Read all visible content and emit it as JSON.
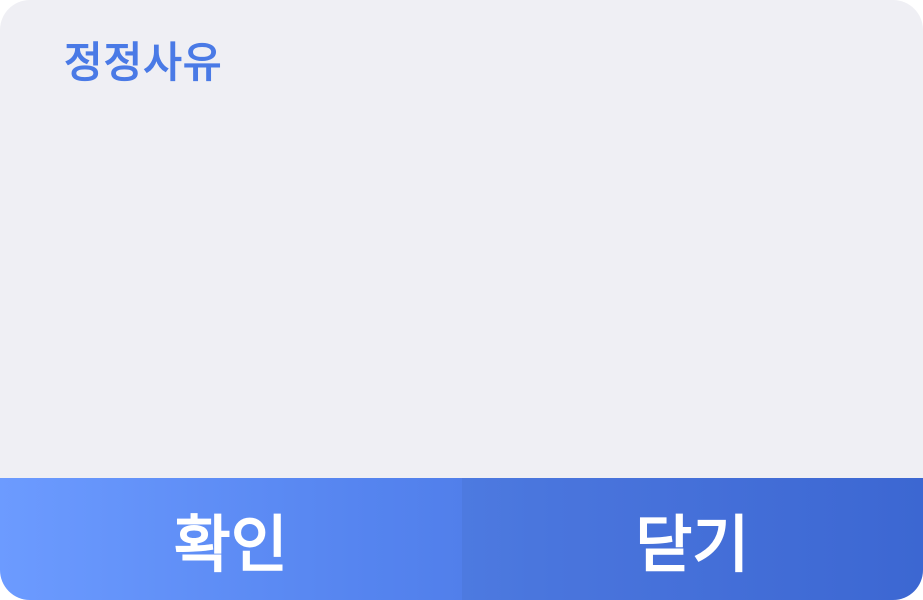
{
  "dialog": {
    "title": "정정사유",
    "buttons": {
      "confirm_label": "확인",
      "close_label": "닫기"
    },
    "colors": {
      "title": "#4a7ae6",
      "background": "#efeff4",
      "button_gradient_start": "#6c9bff",
      "button_gradient_end": "#3f6cdb",
      "button_text": "#ffffff"
    }
  }
}
